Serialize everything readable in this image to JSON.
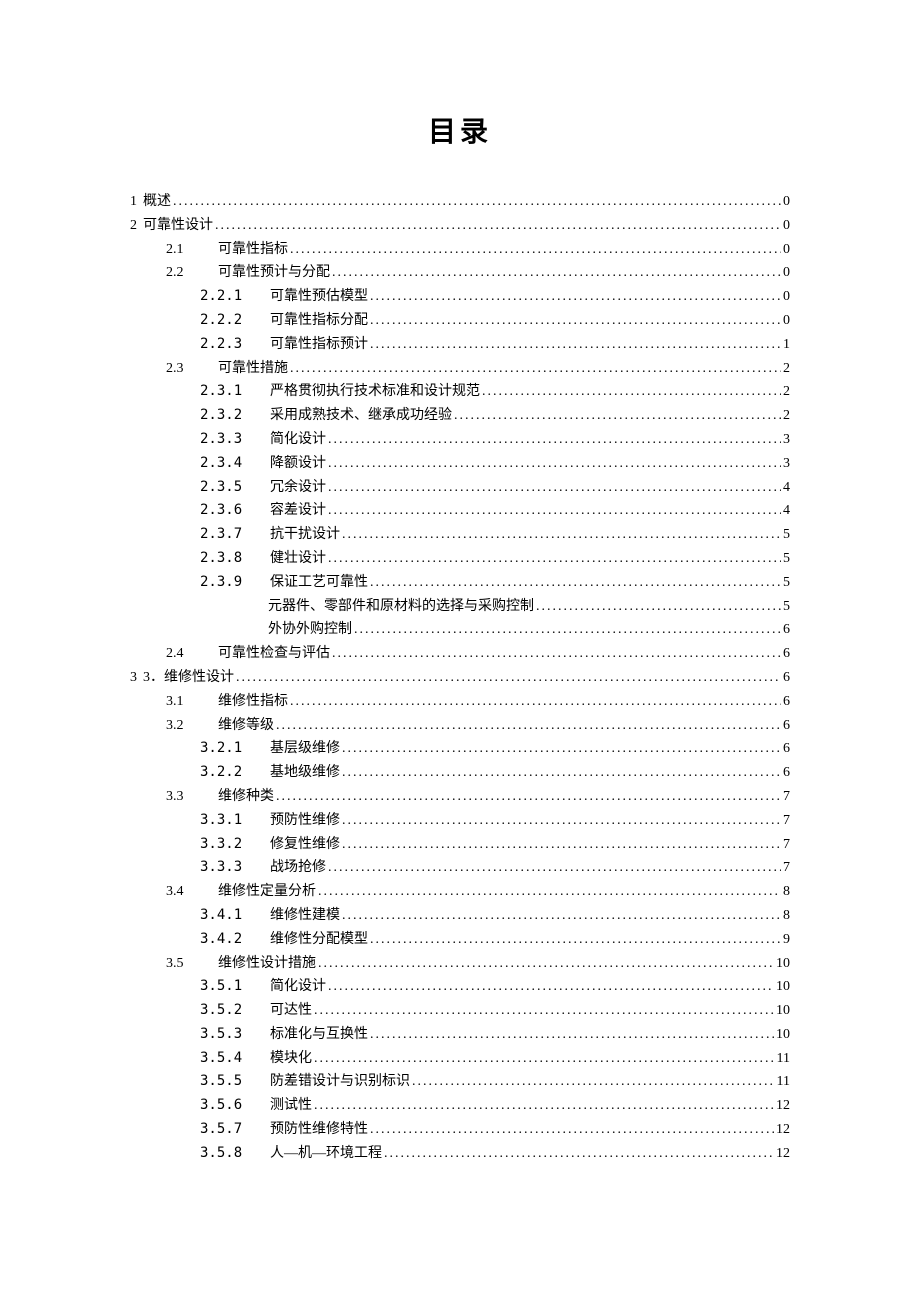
{
  "title": "目录",
  "entries": [
    {
      "level": 1,
      "num": "1",
      "label": "概述",
      "page": "0"
    },
    {
      "level": 1,
      "num": "2",
      "label": "可靠性设计",
      "page": "0"
    },
    {
      "level": 2,
      "num": "2.1",
      "label": "可靠性指标",
      "page": "0"
    },
    {
      "level": 2,
      "num": "2.2",
      "label": "可靠性预计与分配",
      "page": "0"
    },
    {
      "level": 3,
      "num": "2.2.1",
      "label": "可靠性预估模型",
      "page": "0"
    },
    {
      "level": 3,
      "num": "2.2.2",
      "label": "可靠性指标分配",
      "page": "0"
    },
    {
      "level": 3,
      "num": "2.2.3",
      "label": "可靠性指标预计",
      "page": "1"
    },
    {
      "level": 2,
      "num": "2.3",
      "label": "可靠性措施",
      "page": "2"
    },
    {
      "level": 3,
      "num": "2.3.1",
      "label": "严格贯彻执行技术标准和设计规范",
      "page": "2"
    },
    {
      "level": 3,
      "num": "2.3.2",
      "label": "采用成熟技术、继承成功经验",
      "page": "2"
    },
    {
      "level": 3,
      "num": "2.3.3",
      "label": "简化设计",
      "page": "3"
    },
    {
      "level": 3,
      "num": "2.3.4",
      "label": "降额设计",
      "page": "3"
    },
    {
      "level": 3,
      "num": "2.3.5",
      "label": "冗余设计",
      "page": "4"
    },
    {
      "level": 3,
      "num": "2.3.6",
      "label": "容差设计",
      "page": "4"
    },
    {
      "level": 3,
      "num": "2.3.7",
      "label": "抗干扰设计",
      "page": "5"
    },
    {
      "level": 3,
      "num": "2.3.8",
      "label": "健壮设计",
      "page": "5"
    },
    {
      "level": 3,
      "num": "2.3.9",
      "label": "保证工艺可靠性",
      "page": "5"
    },
    {
      "level": 4,
      "num": "",
      "label": "元器件、零部件和原材料的选择与采购控制",
      "page": "5"
    },
    {
      "level": 4,
      "num": "",
      "label": "外协外购控制",
      "page": "6"
    },
    {
      "level": 2,
      "num": "2.4",
      "label": "可靠性检查与评估",
      "page": "6"
    },
    {
      "level": 1,
      "num": "3",
      "label": "3．维修性设计",
      "page": "6"
    },
    {
      "level": 2,
      "num": "3.1",
      "label": "维修性指标",
      "page": "6"
    },
    {
      "level": 2,
      "num": "3.2",
      "label": "维修等级",
      "page": "6"
    },
    {
      "level": 3,
      "num": "3.2.1",
      "label": "基层级维修",
      "page": "6"
    },
    {
      "level": 3,
      "num": "3.2.2",
      "label": "基地级维修",
      "page": "6"
    },
    {
      "level": 2,
      "num": "3.3",
      "label": "维修种类",
      "page": "7"
    },
    {
      "level": 3,
      "num": "3.3.1",
      "label": "预防性维修",
      "page": "7"
    },
    {
      "level": 3,
      "num": "3.3.2",
      "label": "修复性维修",
      "page": "7"
    },
    {
      "level": 3,
      "num": "3.3.3",
      "label": "战场抢修",
      "page": "7"
    },
    {
      "level": 2,
      "num": "3.4",
      "label": "维修性定量分析",
      "page": "8"
    },
    {
      "level": 3,
      "num": "3.4.1",
      "label": "维修性建模",
      "page": "8"
    },
    {
      "level": 3,
      "num": "3.4.2",
      "label": "维修性分配模型",
      "page": "9"
    },
    {
      "level": 2,
      "num": "3.5",
      "label": "维修性设计措施",
      "page": "10"
    },
    {
      "level": 3,
      "num": "3.5.1",
      "label": "简化设计",
      "page": "10"
    },
    {
      "level": 3,
      "num": "3.5.2",
      "label": "可达性",
      "page": "10"
    },
    {
      "level": 3,
      "num": "3.5.3",
      "label": "标准化与互换性",
      "page": "10"
    },
    {
      "level": 3,
      "num": "3.5.4",
      "label": "模块化",
      "page": "11"
    },
    {
      "level": 3,
      "num": "3.5.5",
      "label": "防差错设计与识别标识",
      "page": "11"
    },
    {
      "level": 3,
      "num": "3.5.6",
      "label": "测试性",
      "page": "12"
    },
    {
      "level": 3,
      "num": "3.5.7",
      "label": "预防性维修特性",
      "page": "12"
    },
    {
      "level": 3,
      "num": "3.5.8",
      "label": "人—机—环境工程",
      "page": "12"
    }
  ]
}
